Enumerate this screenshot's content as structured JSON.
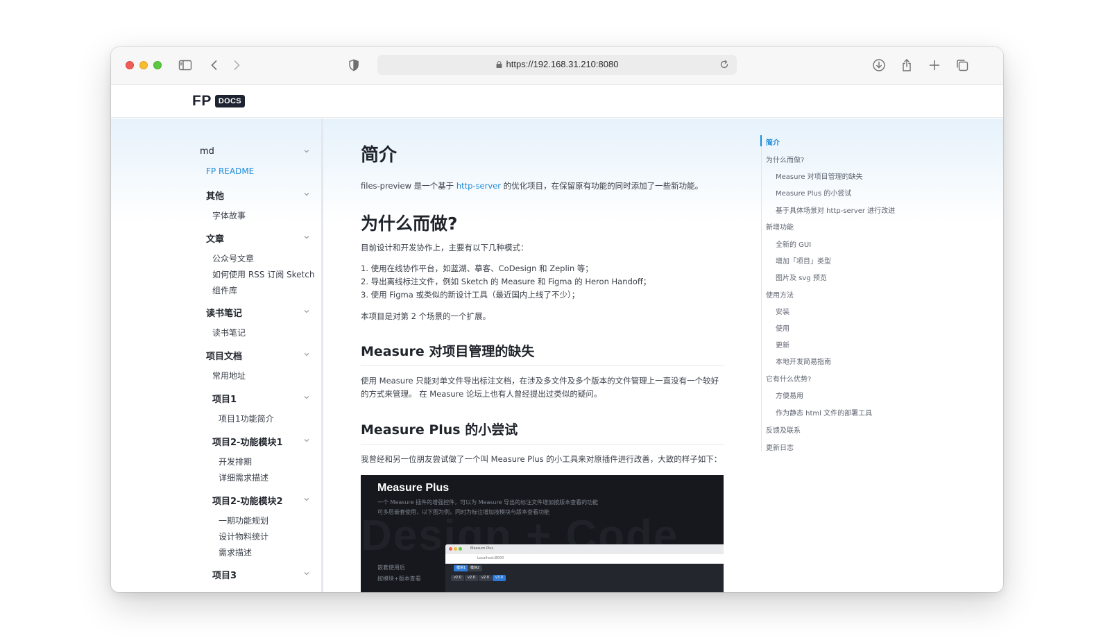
{
  "browser": {
    "url": "https://192.168.31.210:8080",
    "icons": [
      "sidebar-icon",
      "back-icon",
      "forward-icon",
      "shield-icon",
      "lock-icon",
      "reload-icon",
      "download-icon",
      "share-icon",
      "new-tab-icon",
      "tabs-overview-icon"
    ]
  },
  "site": {
    "logo_fp": "FP",
    "logo_docs": "DOCS"
  },
  "sidebar": {
    "root": "md",
    "items": [
      {
        "label": "FP README"
      },
      {
        "label": "其他"
      },
      {
        "label": "字体故事"
      },
      {
        "label": "文章"
      },
      {
        "label": "公众号文章"
      },
      {
        "label": "如何使用 RSS 订阅 Sketch"
      },
      {
        "label": "组件库"
      },
      {
        "label": "读书笔记"
      },
      {
        "label": "读书笔记"
      },
      {
        "label": "项目文档"
      },
      {
        "label": "常用地址"
      },
      {
        "label": "项目1"
      },
      {
        "label": "项目1功能简介"
      },
      {
        "label": "项目2-功能模块1"
      },
      {
        "label": "开发排期"
      },
      {
        "label": "详细需求描述"
      },
      {
        "label": "项目2-功能模块2"
      },
      {
        "label": "一期功能规划"
      },
      {
        "label": "设计物料统计"
      },
      {
        "label": "需求描述"
      },
      {
        "label": "项目3"
      }
    ]
  },
  "main": {
    "h1": "简介",
    "intro_before": "files-preview 是一个基于 ",
    "intro_link": "http-server",
    "intro_after": " 的优化项目，在保留原有功能的同时添加了一些新功能。",
    "h_why": "为什么而做?",
    "why_lead": "目前设计和开发协作上，主要有以下几种模式：",
    "why_list": [
      "1. 使用在线协作平台，如蓝湖、摹客、CoDesign 和 Zeplin 等；",
      "2. 导出离线标注文件，例如 Sketch 的 Measure 和 Figma 的 Heron Handoff；",
      "3. 使用 Figma 或类似的新设计工具（最近国内上线了不少）；"
    ],
    "why_note": "本项目是对第 2 个场景的一个扩展。",
    "h_measure": "Measure 对项目管理的缺失",
    "measure_text": "使用 Measure 只能对单文件导出标注文档，在涉及多文件及多个版本的文件管理上一直没有一个较好的方式来管理。 在 Measure 论坛上也有人曾经提出过类似的疑问。",
    "h_plus": "Measure Plus 的小尝试",
    "plus_text": "我曾经和另一位朋友尝试做了一个叫 Measure Plus 的小工具来对原插件进行改善，大致的样子如下：",
    "image": {
      "title": "Measure Plus",
      "desc1": "一个 Measure 插件的增强控件，可以为 Measure 导出的标注文件增加按版本查看的功能",
      "desc2": "可多层嵌套使用，以下图为例，同时为标注增加按模块与版本查看功能",
      "watermark": "Design + Code",
      "side1": "嵌套使用后",
      "side2": "按模块+版本查看",
      "shot_tab": "Measure Plus",
      "shot_url": "Localhost:8000",
      "chips": [
        "模块1",
        "模块2",
        "v2.0",
        "v2.0",
        "v2.0",
        "v3.0"
      ]
    }
  },
  "toc": {
    "items": [
      {
        "label": "简介"
      },
      {
        "label": "为什么而做?"
      },
      {
        "label": "Measure 对项目管理的缺失"
      },
      {
        "label": "Measure Plus 的小尝试"
      },
      {
        "label": "基于具体场景对 http-server 进行改进"
      },
      {
        "label": "新增功能"
      },
      {
        "label": "全新的 GUI"
      },
      {
        "label": "增加「项目」类型"
      },
      {
        "label": "图片及 svg 预览"
      },
      {
        "label": "使用方法"
      },
      {
        "label": "安装"
      },
      {
        "label": "使用"
      },
      {
        "label": "更新"
      },
      {
        "label": "本地开发简易指南"
      },
      {
        "label": "它有什么优势?"
      },
      {
        "label": "方便易用"
      },
      {
        "label": "作为静态 html 文件的部署工具"
      },
      {
        "label": "反馈及联系"
      },
      {
        "label": "更新日志"
      }
    ]
  },
  "colors": {
    "accent": "#1a8ad8",
    "toolbar": "#f7f7f7",
    "text": "#2c3038",
    "image_bg": "#16181d"
  }
}
